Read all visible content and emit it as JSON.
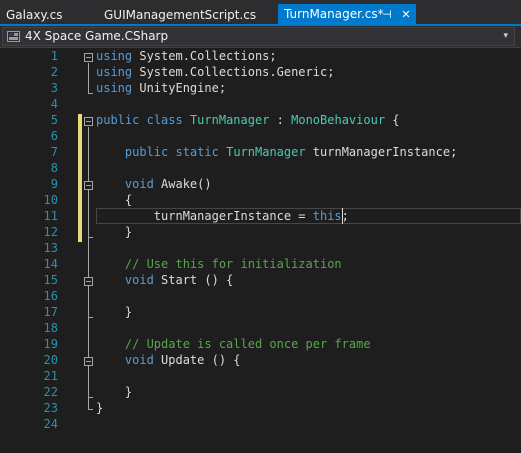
{
  "tabs": [
    {
      "label": "Galaxy.cs",
      "active": false
    },
    {
      "label": "GUIManagementScript.cs",
      "active": false
    },
    {
      "label": "TurnManager.cs*",
      "active": true
    }
  ],
  "tab_pin_glyph": "⊣",
  "tab_close_glyph": "✕",
  "navbar": {
    "project": "4X Space Game.CSharp",
    "chevron": "▾"
  },
  "colors": {
    "accent": "#007acc",
    "keyword": "#569cd6",
    "type": "#4ec9b0",
    "comment": "#57a64a",
    "line_number": "#2b91af",
    "changed_margin": "#e6db74",
    "text": "#dcdcdc"
  },
  "editor": {
    "current_line": 11,
    "line_numbers": [
      "1",
      "2",
      "3",
      "4",
      "5",
      "6",
      "7",
      "8",
      "9",
      "10",
      "11",
      "12",
      "13",
      "14",
      "15",
      "16",
      "17",
      "18",
      "19",
      "20",
      "21",
      "22",
      "23",
      "24"
    ],
    "lines": [
      [
        {
          "t": "using",
          "c": "kw"
        },
        {
          "t": " System.Collections;"
        }
      ],
      [
        {
          "t": "using",
          "c": "kw"
        },
        {
          "t": " System.Collections.Generic;"
        }
      ],
      [
        {
          "t": "using",
          "c": "kw"
        },
        {
          "t": " UnityEngine;"
        }
      ],
      [],
      [
        {
          "t": "public",
          "c": "kw"
        },
        {
          "t": " "
        },
        {
          "t": "class",
          "c": "kw"
        },
        {
          "t": " "
        },
        {
          "t": "TurnManager",
          "c": "type"
        },
        {
          "t": " : "
        },
        {
          "t": "MonoBehaviour",
          "c": "type"
        },
        {
          "t": " {"
        }
      ],
      [],
      [
        {
          "t": "    "
        },
        {
          "t": "public",
          "c": "kw"
        },
        {
          "t": " "
        },
        {
          "t": "static",
          "c": "kw"
        },
        {
          "t": " "
        },
        {
          "t": "TurnManager",
          "c": "type"
        },
        {
          "t": " turnManagerInstance;"
        }
      ],
      [],
      [
        {
          "t": "    "
        },
        {
          "t": "void",
          "c": "kw"
        },
        {
          "t": " Awake()"
        }
      ],
      [
        {
          "t": "    {"
        }
      ],
      [
        {
          "t": "        turnManagerInstance = "
        },
        {
          "t": "this",
          "c": "kw"
        },
        {
          "t": ";"
        }
      ],
      [
        {
          "t": "    }"
        }
      ],
      [],
      [
        {
          "t": "    "
        },
        {
          "t": "// Use this for initialization",
          "c": "cm"
        }
      ],
      [
        {
          "t": "    "
        },
        {
          "t": "void",
          "c": "kw"
        },
        {
          "t": " Start () {"
        }
      ],
      [],
      [
        {
          "t": "    }"
        }
      ],
      [],
      [
        {
          "t": "    "
        },
        {
          "t": "// Update is called once per frame",
          "c": "cm"
        }
      ],
      [
        {
          "t": "    "
        },
        {
          "t": "void",
          "c": "kw"
        },
        {
          "t": " Update () {"
        }
      ],
      [],
      [
        {
          "t": "    }"
        }
      ],
      [
        {
          "t": "}"
        }
      ],
      []
    ]
  }
}
